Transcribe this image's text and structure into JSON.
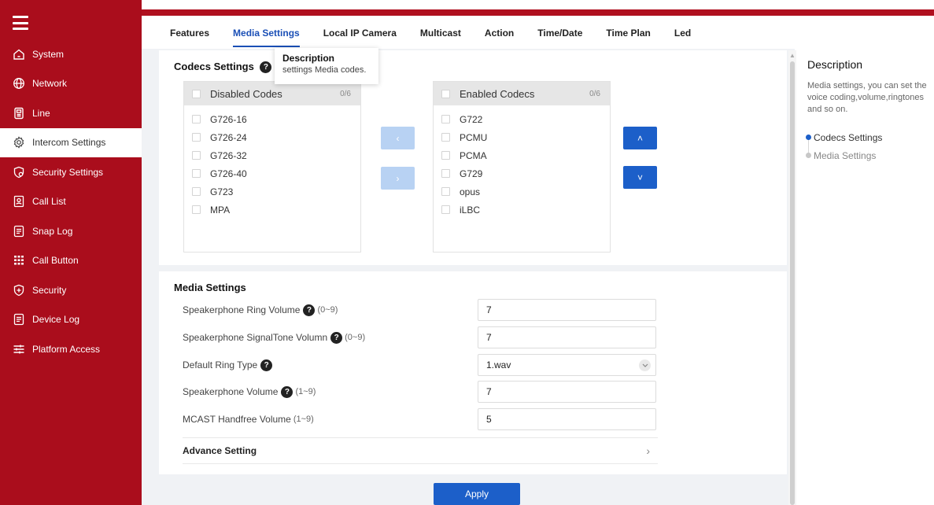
{
  "sidebar": {
    "items": [
      {
        "label": "System",
        "icon": "home-icon",
        "active": false
      },
      {
        "label": "Network",
        "icon": "globe-icon",
        "active": false
      },
      {
        "label": "Line",
        "icon": "phone-icon",
        "active": false
      },
      {
        "label": "Intercom Settings",
        "icon": "gear-icon",
        "active": true
      },
      {
        "label": "Security Settings",
        "icon": "shield-gear-icon",
        "active": false
      },
      {
        "label": "Call List",
        "icon": "contacts-icon",
        "active": false
      },
      {
        "label": "Snap Log",
        "icon": "document-icon",
        "active": false
      },
      {
        "label": "Call Button",
        "icon": "keypad-icon",
        "active": false
      },
      {
        "label": "Security",
        "icon": "shield-plus-icon",
        "active": false
      },
      {
        "label": "Device Log",
        "icon": "log-icon",
        "active": false
      },
      {
        "label": "Platform Access",
        "icon": "sliders-icon",
        "active": false
      }
    ]
  },
  "tabs": [
    {
      "label": "Features",
      "active": false
    },
    {
      "label": "Media Settings",
      "active": true
    },
    {
      "label": "Local IP Camera",
      "active": false
    },
    {
      "label": "Multicast",
      "active": false
    },
    {
      "label": "Action",
      "active": false
    },
    {
      "label": "Time/Date",
      "active": false
    },
    {
      "label": "Time Plan",
      "active": false
    },
    {
      "label": "Led",
      "active": false
    }
  ],
  "codecs": {
    "title": "Codecs Settings",
    "help_glyph": "?",
    "tooltip": {
      "title": "Description",
      "text": "settings Media codes."
    },
    "disabled": {
      "header": "Disabled Codes",
      "count": "0/6",
      "items": [
        "G726-16",
        "G726-24",
        "G726-32",
        "G726-40",
        "G723",
        "MPA"
      ]
    },
    "enabled": {
      "header": "Enabled Codecs",
      "count": "0/6",
      "items": [
        "G722",
        "PCMU",
        "PCMA",
        "G729",
        "opus",
        "iLBC"
      ]
    },
    "buttons": {
      "left": "‹",
      "right": "›",
      "up": "˄",
      "down": "˅"
    }
  },
  "media": {
    "title": "Media Settings",
    "fields": [
      {
        "label": "Speakerphone Ring Volume",
        "help": true,
        "range": "(0~9)",
        "value": "7",
        "type": "input"
      },
      {
        "label": "Speakerphone SignalTone Volumn",
        "help": true,
        "range": "(0~9)",
        "value": "7",
        "type": "input"
      },
      {
        "label": "Default Ring Type",
        "help": true,
        "range": "",
        "value": "1.wav",
        "type": "select"
      },
      {
        "label": "Speakerphone Volume",
        "help": true,
        "range": "(1~9)",
        "value": "7",
        "type": "input"
      },
      {
        "label": "MCAST Handfree Volume",
        "help": false,
        "range": "(1~9)",
        "value": "5",
        "type": "input"
      }
    ],
    "advance_label": "Advance Setting",
    "advance_chevron": "›",
    "apply_label": "Apply"
  },
  "description": {
    "title": "Description",
    "text": "Media settings, you can set the voice coding,volume,ringtones and so on.",
    "anchors": [
      {
        "label": "Codecs Settings",
        "active": true
      },
      {
        "label": "Media Settings",
        "active": false
      }
    ]
  },
  "colors": {
    "sidebar_bg": "#aa0d1c",
    "accent": "#1c5fc9",
    "tab_active": "#1a4fb6"
  }
}
